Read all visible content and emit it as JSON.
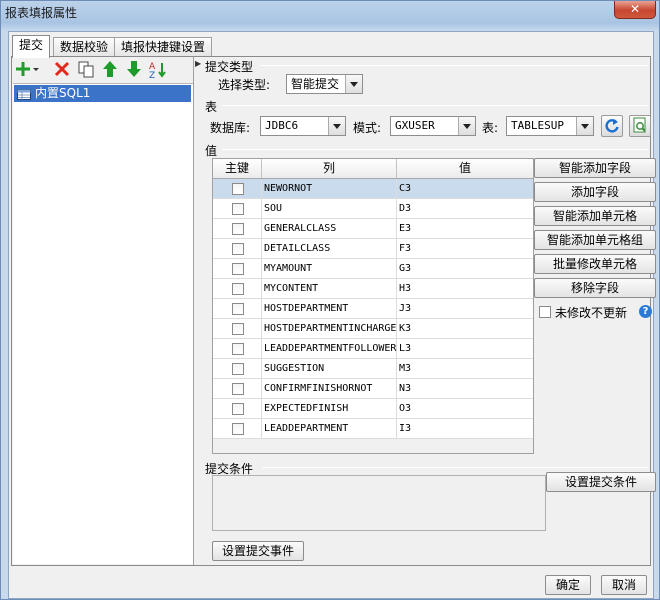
{
  "window": {
    "title": "报表填报属性",
    "close_glyph": "✕"
  },
  "tabs": [
    {
      "label": "提交",
      "active": true
    },
    {
      "label": "数据校验",
      "active": false
    },
    {
      "label": "填报快捷键设置",
      "active": false
    }
  ],
  "left": {
    "toolbar_icons": [
      "add-icon",
      "delete-icon",
      "copy-icon",
      "move-up-icon",
      "move-down-icon",
      "sort-icon"
    ],
    "tree": [
      {
        "label": "内置SQL1",
        "icon": "sql-table-icon",
        "selected": true
      }
    ]
  },
  "submit_type": {
    "section": "提交类型",
    "label": "选择类型:",
    "value": "智能提交"
  },
  "table_section": {
    "section": "表",
    "database_label": "数据库:",
    "database_value": "JDBC6",
    "schema_label": "模式:",
    "schema_value": "GXUSER",
    "table_label": "表:",
    "table_value": "TABLESUP",
    "refresh_icon": "refresh-icon",
    "preview_icon": "preview-icon"
  },
  "values_section": {
    "section": "值",
    "headers": {
      "key": "主键",
      "column": "列",
      "value": "值"
    },
    "rows": [
      {
        "column": "NEWORNOT",
        "value": "C3",
        "selected": true
      },
      {
        "column": "SOU",
        "value": "D3"
      },
      {
        "column": "GENERALCLASS",
        "value": "E3"
      },
      {
        "column": "DETAILCLASS",
        "value": "F3"
      },
      {
        "column": "MYAMOUNT",
        "value": "G3"
      },
      {
        "column": "MYCONTENT",
        "value": "H3"
      },
      {
        "column": "HOSTDEPARTMENT",
        "value": "J3"
      },
      {
        "column": "HOSTDEPARTMENTINCHARGE",
        "value": "K3"
      },
      {
        "column": "LEADDEPARTMENTFOLLOWER",
        "value": "L3"
      },
      {
        "column": "SUGGESTION",
        "value": "M3"
      },
      {
        "column": "CONFIRMFINISHORNOT",
        "value": "N3"
      },
      {
        "column": "EXPECTEDFINISH",
        "value": "O3"
      },
      {
        "column": "LEADDEPARTMENT",
        "value": "I3"
      }
    ],
    "buttons": {
      "smart_add_field": "智能添加字段",
      "add_field": "添加字段",
      "smart_add_cell": "智能添加单元格",
      "smart_add_cell_group": "智能添加单元格组",
      "batch_modify_cell": "批量修改单元格",
      "remove_field": "移除字段"
    },
    "no_update_label": "未修改不更新",
    "help_glyph": "?"
  },
  "condition_section": {
    "section": "提交条件",
    "set_condition": "设置提交条件"
  },
  "set_event": "设置提交事件",
  "dialog_buttons": {
    "ok": "确定",
    "cancel": "取消"
  }
}
